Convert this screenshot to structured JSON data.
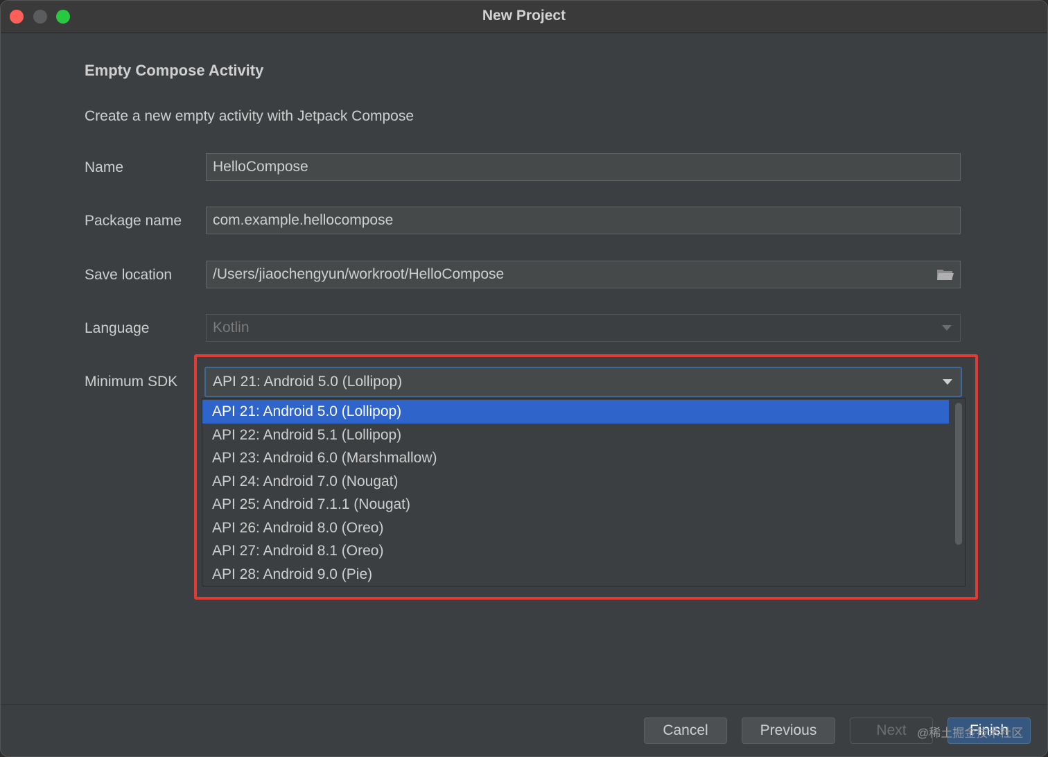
{
  "window": {
    "title": "New Project"
  },
  "page": {
    "heading": "Empty Compose Activity",
    "description": "Create a new empty activity with Jetpack Compose"
  },
  "form": {
    "name": {
      "label": "Name",
      "value": "HelloCompose"
    },
    "package": {
      "label": "Package name",
      "value": "com.example.hellocompose"
    },
    "save_location": {
      "label": "Save location",
      "value": "/Users/jiaochengyun/workroot/HelloCompose",
      "icon": "folder-icon"
    },
    "language": {
      "label": "Language",
      "value": "Kotlin"
    },
    "min_sdk": {
      "label": "Minimum SDK",
      "value": "API 21: Android 5.0 (Lollipop)",
      "options": [
        "API 21: Android 5.0 (Lollipop)",
        "API 22: Android 5.1 (Lollipop)",
        "API 23: Android 6.0 (Marshmallow)",
        "API 24: Android 7.0 (Nougat)",
        "API 25: Android 7.1.1 (Nougat)",
        "API 26: Android 8.0 (Oreo)",
        "API 27: Android 8.1 (Oreo)",
        "API 28: Android 9.0 (Pie)"
      ],
      "selected_index": 0
    }
  },
  "buttons": {
    "cancel": "Cancel",
    "previous": "Previous",
    "next": "Next",
    "finish": "Finish"
  },
  "watermark": "@稀土掘金技术社区",
  "colors": {
    "selection": "#2f65ca",
    "highlight_box": "#e03b35",
    "close": "#fe5f57",
    "zoom": "#28c840"
  }
}
